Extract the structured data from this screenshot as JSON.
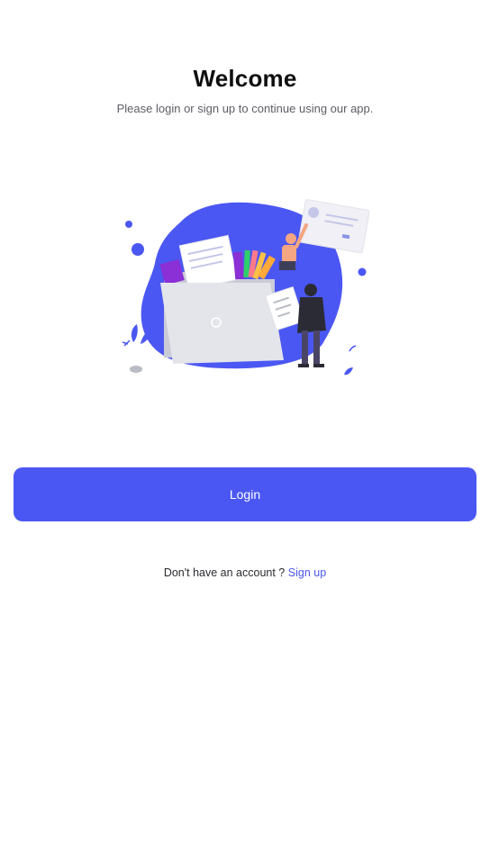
{
  "welcome": {
    "title": "Welcome",
    "subtitle": "Please login or sign up to continue using our app."
  },
  "illustration": {
    "icon": "folder-upload-illustration"
  },
  "actions": {
    "login_label": "Login",
    "no_account_text": "Don't have an account ?",
    "signup_label": "Sign up"
  },
  "colors": {
    "accent": "#4b57f2",
    "title_text": "#0f0f10",
    "body_text": "#5d5d66"
  }
}
